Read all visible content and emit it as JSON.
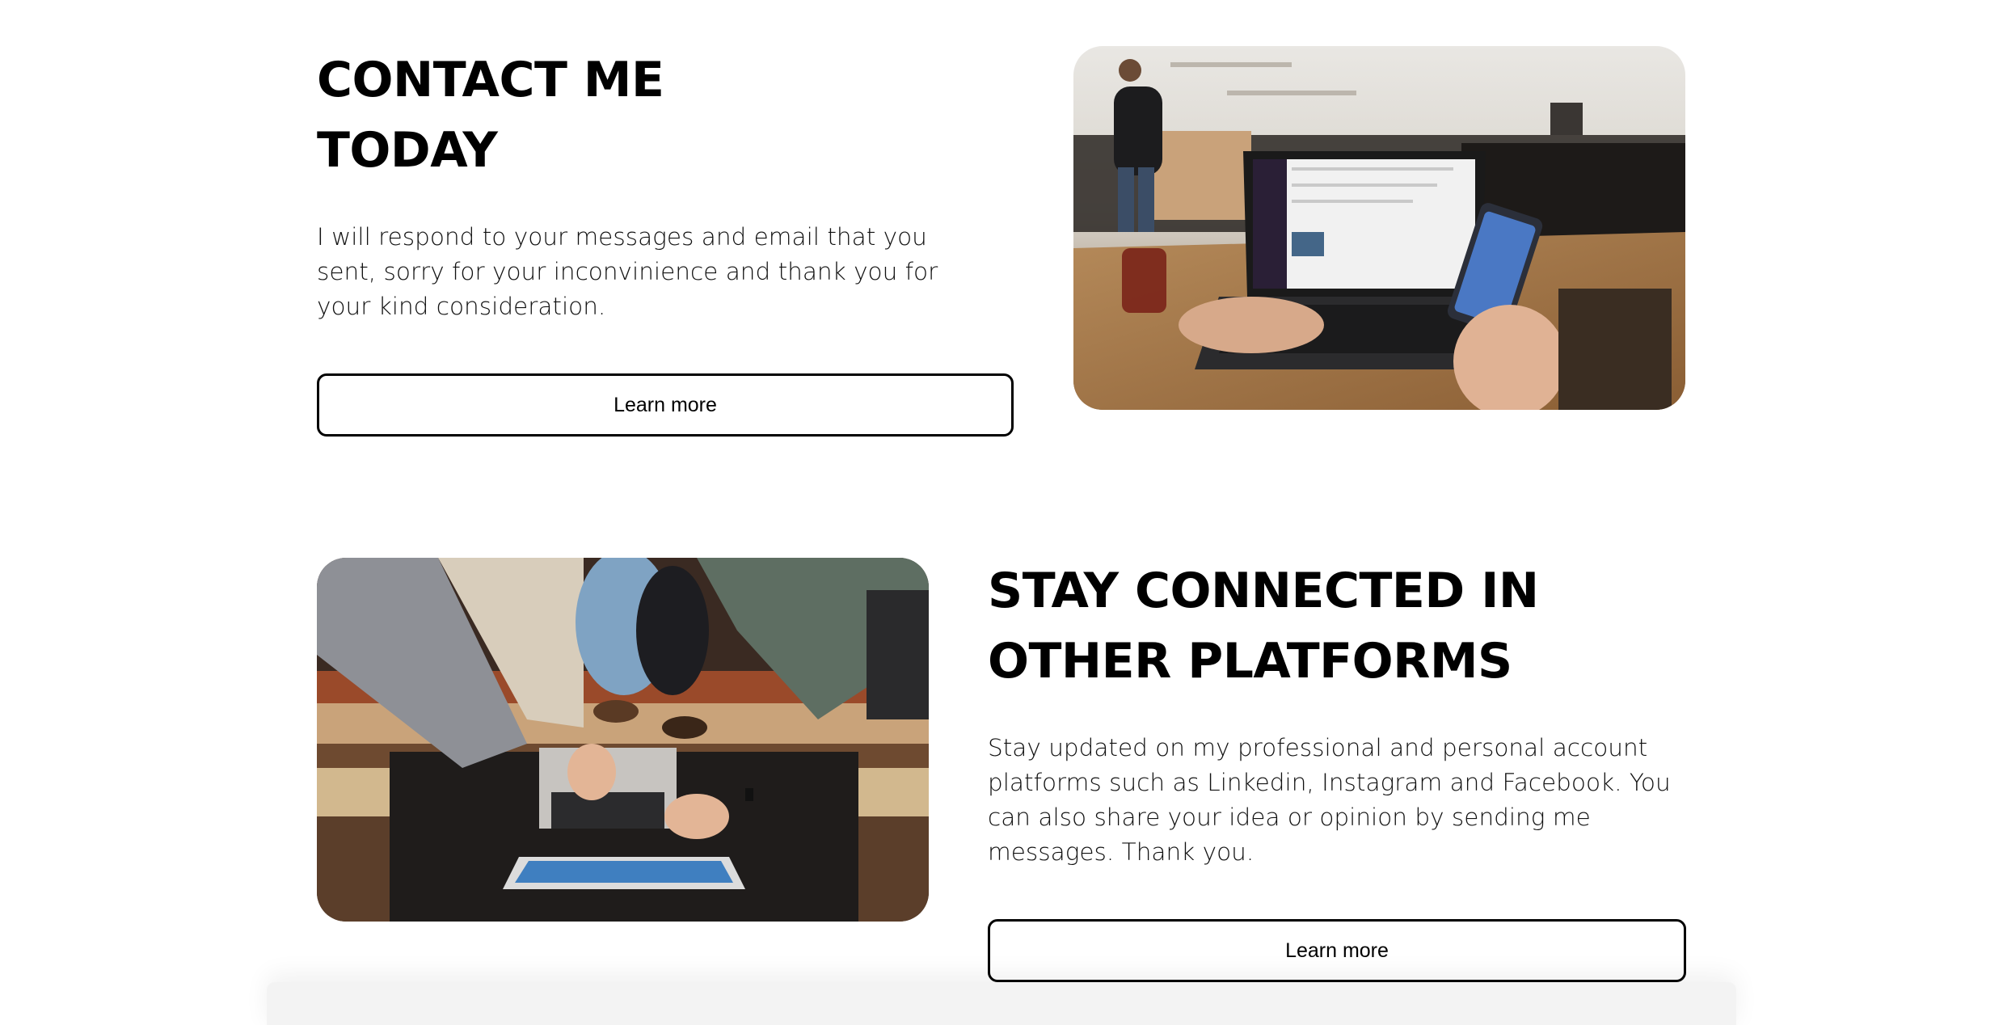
{
  "contact": {
    "heading_line1": "CONTACT ME",
    "heading_line2": "TODAY",
    "body": "I will respond to your messages and email that you sent, sorry for your inconvinience and thank you for your kind consideration.",
    "button_label": "Learn more"
  },
  "connected": {
    "heading_line1": "STAY CONNECTED IN",
    "heading_line2": "OTHER PLATFORMS",
    "body": "Stay updated on my professional and personal account platforms such as Linkedin, Instagram and Facebook. You can also share your idea or opinion by sending me messages. Thank you.",
    "button_label": "Learn more"
  },
  "images": {
    "cafe_photo": "photo-laptop-and-phone-in-cafe",
    "group_photo": "photo-people-around-laptop-and-tablet"
  }
}
